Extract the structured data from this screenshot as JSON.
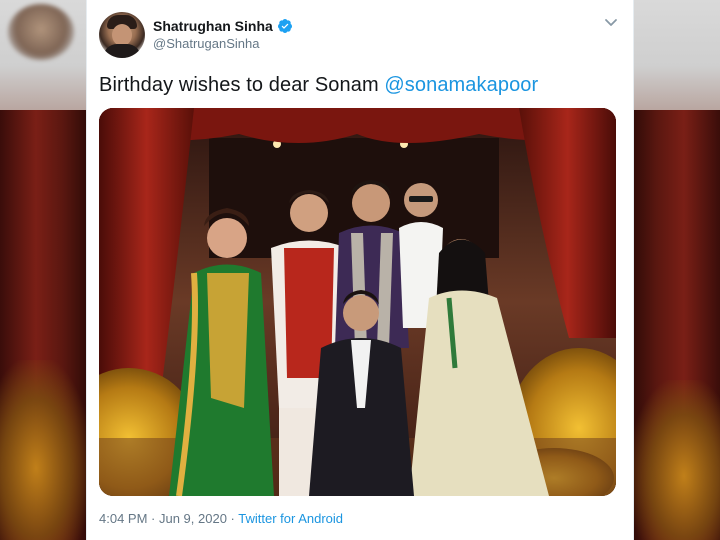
{
  "tweet": {
    "display_name": "Shatrughan Sinha",
    "handle": "@ShatruganSinha",
    "text_prefix": "Birthday wishes to dear Sonam ",
    "mention": "@sonamakapoor",
    "time": "4:04 PM",
    "separator1": " · ",
    "date": "Jun 9, 2020",
    "separator2": " · ",
    "source": "Twitter for Android"
  },
  "icons": {
    "verified": "verified-badge-icon",
    "caret": "chevron-down-icon"
  },
  "colors": {
    "link": "#1b95e0",
    "text": "#14171a",
    "muted": "#657786",
    "verified": "#1da1f2"
  }
}
